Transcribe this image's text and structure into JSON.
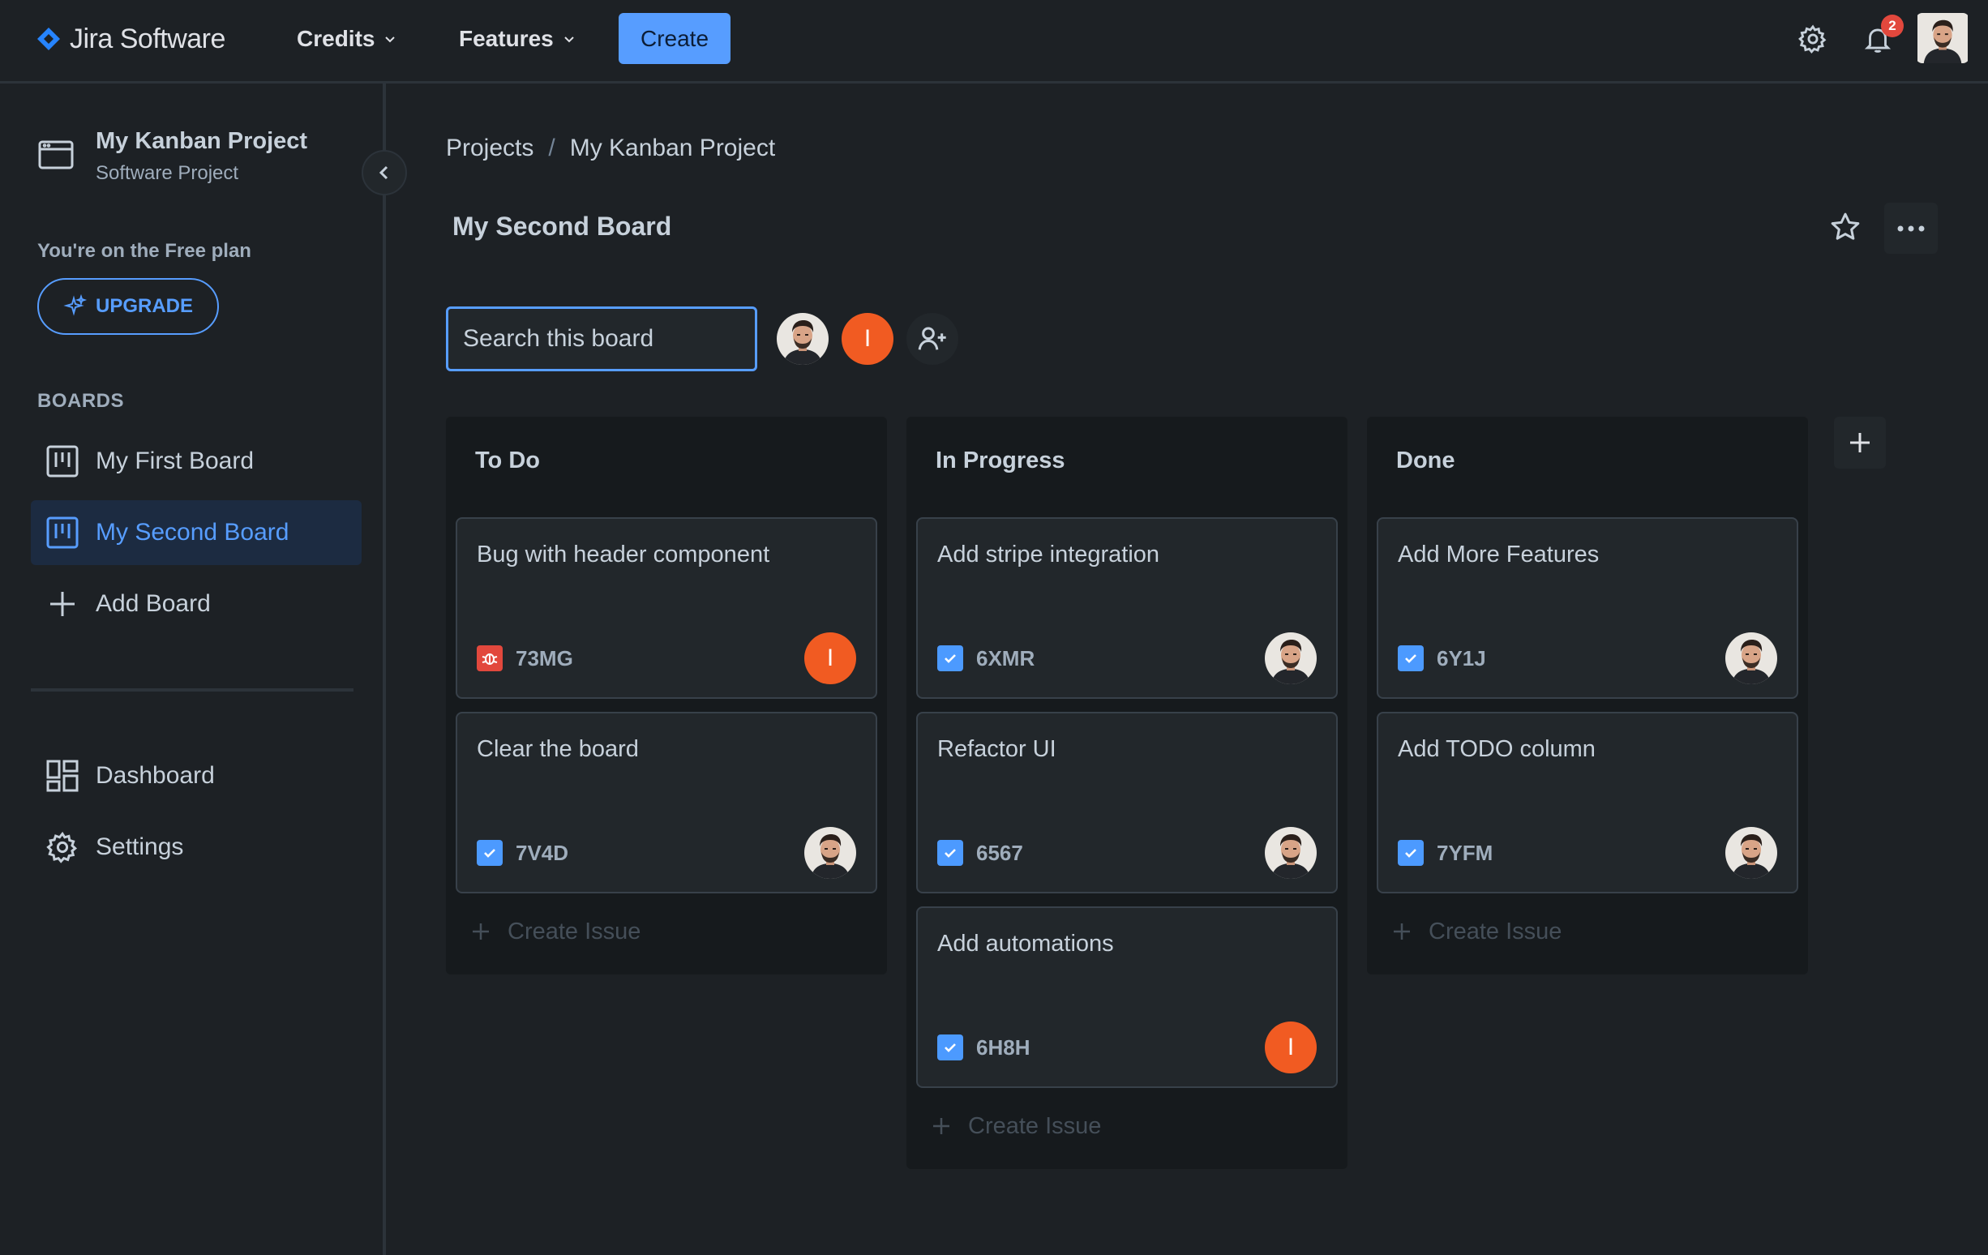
{
  "topbar": {
    "logo_text": "Jira Software",
    "nav": [
      {
        "label": "Credits"
      },
      {
        "label": "Features"
      }
    ],
    "create_label": "Create",
    "notification_count": "2"
  },
  "sidebar": {
    "project_name": "My Kanban Project",
    "project_type": "Software Project",
    "plan_text": "You're on the Free plan",
    "upgrade_label": "UPGRADE",
    "boards_heading": "BOARDS",
    "boards": [
      {
        "label": "My First Board",
        "active": false
      },
      {
        "label": "My Second Board",
        "active": true
      }
    ],
    "add_board_label": "Add Board",
    "dashboard_label": "Dashboard",
    "settings_label": "Settings"
  },
  "main": {
    "breadcrumb": [
      "Projects",
      "/",
      "My Kanban Project"
    ],
    "board_title": "My Second Board",
    "search_placeholder": "Search this board",
    "member_initial": "I",
    "columns": [
      {
        "title": "To Do",
        "cards": [
          {
            "title": "Bug with header component",
            "type": "bug",
            "key": "73MG",
            "assignee": "I"
          },
          {
            "title": "Clear the board",
            "type": "task",
            "key": "7V4D",
            "assignee": "photo"
          }
        ],
        "create_label": "Create Issue"
      },
      {
        "title": "In Progress",
        "cards": [
          {
            "title": "Add stripe integration",
            "type": "task",
            "key": "6XMR",
            "assignee": "photo"
          },
          {
            "title": "Refactor UI",
            "type": "task",
            "key": "6567",
            "assignee": "photo"
          },
          {
            "title": "Add automations",
            "type": "task",
            "key": "6H8H",
            "assignee": "I"
          }
        ],
        "create_label": "Create Issue"
      },
      {
        "title": "Done",
        "cards": [
          {
            "title": "Add More Features",
            "type": "task",
            "key": "6Y1J",
            "assignee": "photo"
          },
          {
            "title": "Add TODO column",
            "type": "task",
            "key": "7YFM",
            "assignee": "photo"
          }
        ],
        "create_label": "Create Issue"
      }
    ]
  },
  "colors": {
    "accent": "#579dff",
    "background": "#1d2125",
    "column_bg": "#161a1d",
    "card_bg": "#22272b",
    "avatar_orange": "#f15b22",
    "bug_red": "#e2483d"
  }
}
